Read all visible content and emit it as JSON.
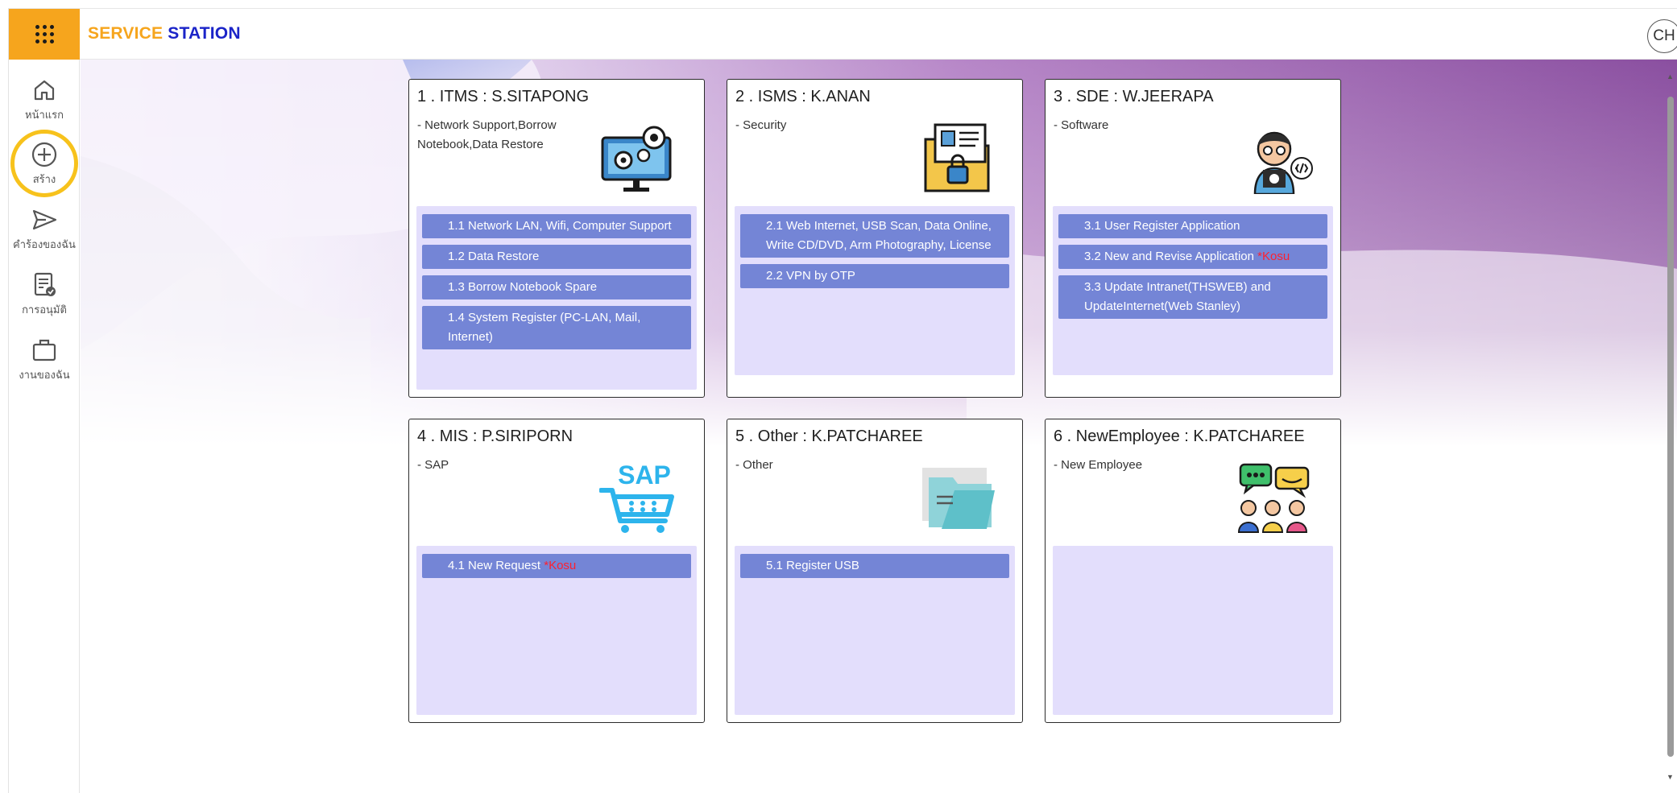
{
  "header": {
    "brand_part1": "SERVICE",
    "brand_part2": "STATION",
    "avatar_initials": "CH"
  },
  "colors": {
    "accent_orange": "#f6a51d",
    "brand_blue": "#1b24c8",
    "menu_item_bg": "#7485d6",
    "menu_box_bg": "#e3defc",
    "highlight_ring": "#f7c21c",
    "tag_red": "#ff1f2e"
  },
  "sidebar": {
    "items": [
      {
        "label": "หน้าแรก",
        "icon": "home-icon"
      },
      {
        "label": "สร้าง",
        "icon": "plus-circle-icon"
      },
      {
        "label": "คำร้องของฉัน",
        "icon": "send-icon"
      },
      {
        "label": "การอนุมัติ",
        "icon": "approval-icon"
      },
      {
        "label": "งานของฉัน",
        "icon": "briefcase-icon"
      }
    ]
  },
  "cards": [
    {
      "title": "1 . ITMS : S.SITAPONG",
      "desc": "- Network Support,Borrow Notebook,Data Restore",
      "icon": "settings-monitor-icon",
      "items": [
        {
          "label": "1.1 Network LAN, Wifi, Computer Support",
          "tag": ""
        },
        {
          "label": "1.2 Data Restore",
          "tag": ""
        },
        {
          "label": "1.3 Borrow Notebook Spare",
          "tag": ""
        },
        {
          "label": "1.4 System Register (PC-LAN, Mail, Internet)",
          "tag": ""
        }
      ]
    },
    {
      "title": "2 . ISMS : K.ANAN",
      "desc": "- Security",
      "icon": "secure-folder-icon",
      "items": [
        {
          "label": "2.1 Web Internet, USB Scan, Data Online, Write CD/DVD, Arm Photography, License",
          "tag": ""
        },
        {
          "label": "2.2 VPN by OTP",
          "tag": ""
        }
      ]
    },
    {
      "title": "3 . SDE : W.JEERAPA",
      "desc": "- Software",
      "icon": "developer-icon",
      "items": [
        {
          "label": "3.1 User Register Application",
          "tag": ""
        },
        {
          "label": "3.2 New and Revise Application ",
          "tag": "*Kosu"
        },
        {
          "label": "3.3 Update Intranet(THSWEB) and UpdateInternet(Web Stanley)",
          "tag": ""
        }
      ]
    },
    {
      "title": "4 . MIS : P.SIRIPORN",
      "desc": "- SAP",
      "icon": "sap-cart-icon",
      "items": [
        {
          "label": "4.1 New Request ",
          "tag": "*Kosu"
        }
      ]
    },
    {
      "title": "5 . Other : K.PATCHAREE",
      "desc": "- Other",
      "icon": "folder-icon",
      "items": [
        {
          "label": "5.1 Register USB",
          "tag": ""
        }
      ]
    },
    {
      "title": "6 . NewEmployee : K.PATCHAREE",
      "desc": "- New Employee",
      "icon": "people-chat-icon",
      "items": []
    }
  ]
}
